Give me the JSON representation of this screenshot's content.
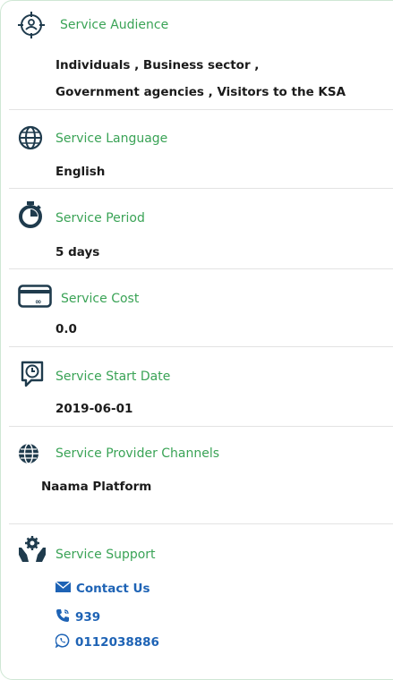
{
  "audience": {
    "title": "Service Audience",
    "line1": "Individuals , Business sector ,",
    "line2": "Government agencies , Visitors to the KSA"
  },
  "language": {
    "title": "Service Language",
    "value": "English"
  },
  "period": {
    "title": "Service Period",
    "value": "5 days"
  },
  "cost": {
    "title": "Service Cost",
    "value": "0.0"
  },
  "start_date": {
    "title": "Service Start Date",
    "value": "2019-06-01"
  },
  "channels": {
    "title": "Service Provider Channels",
    "value": "Naama Platform"
  },
  "support": {
    "title": "Service Support",
    "contact": "Contact Us",
    "phone": "939",
    "whatsapp": "0112038886"
  },
  "colors": {
    "title": "#3aa356",
    "link": "#1e63b5",
    "icon": "#1f3b4d"
  }
}
